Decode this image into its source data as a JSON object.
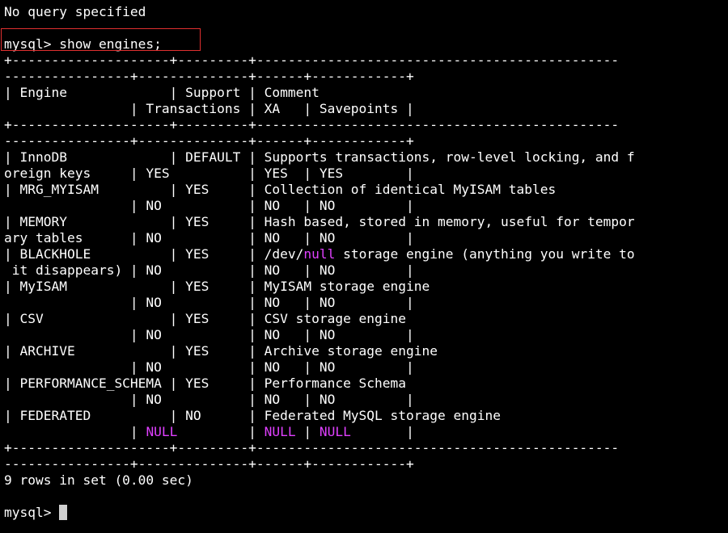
{
  "colors": {
    "background": "#000000",
    "text": "#ffffff",
    "null_highlight": "#e040ff",
    "annotation_box": "#e03030",
    "cursor": "#cfcfcf"
  },
  "lines": [
    [
      {
        "t": "No query specified"
      }
    ],
    [
      {
        "t": ""
      }
    ],
    [
      {
        "t": "mysql> show engines;"
      }
    ],
    [
      {
        "t": "+--------------------+---------+----------------------------------------------"
      }
    ],
    [
      {
        "t": "----------------+--------------+------+------------+"
      }
    ],
    [
      {
        "t": "| Engine             | Support | Comment"
      }
    ],
    [
      {
        "t": "                | Transactions | XA   | Savepoints |"
      }
    ],
    [
      {
        "t": "+--------------------+---------+----------------------------------------------"
      }
    ],
    [
      {
        "t": "----------------+--------------+------+------------+"
      }
    ],
    [
      {
        "t": "| InnoDB             | DEFAULT | Supports transactions, row-level locking, and f"
      }
    ],
    [
      {
        "t": "oreign keys     | YES          | YES  | YES        |"
      }
    ],
    [
      {
        "t": "| MRG_MYISAM         | YES     | Collection of identical MyISAM tables"
      }
    ],
    [
      {
        "t": "                | NO           | NO   | NO         |"
      }
    ],
    [
      {
        "t": "| MEMORY             | YES     | Hash based, stored in memory, useful for tempor"
      }
    ],
    [
      {
        "t": "ary tables      | NO           | NO   | NO         |"
      }
    ],
    [
      {
        "t": "| BLACKHOLE          | YES     | /dev/"
      },
      {
        "t": "null",
        "c": "magenta"
      },
      {
        "t": " storage engine (anything you write to"
      }
    ],
    [
      {
        "t": " it disappears) | NO           | NO   | NO         |"
      }
    ],
    [
      {
        "t": "| MyISAM             | YES     | MyISAM storage engine"
      }
    ],
    [
      {
        "t": "                | NO           | NO   | NO         |"
      }
    ],
    [
      {
        "t": "| CSV                | YES     | CSV storage engine"
      }
    ],
    [
      {
        "t": "                | NO           | NO   | NO         |"
      }
    ],
    [
      {
        "t": "| ARCHIVE            | YES     | Archive storage engine"
      }
    ],
    [
      {
        "t": "                | NO           | NO   | NO         |"
      }
    ],
    [
      {
        "t": "| PERFORMANCE_SCHEMA | YES     | Performance Schema"
      }
    ],
    [
      {
        "t": "                | NO           | NO   | NO         |"
      }
    ],
    [
      {
        "t": "| FEDERATED          | NO      | Federated MySQL storage engine"
      }
    ],
    [
      {
        "t": "                | "
      },
      {
        "t": "NULL",
        "c": "magenta"
      },
      {
        "t": "         | "
      },
      {
        "t": "NULL",
        "c": "magenta"
      },
      {
        "t": " | "
      },
      {
        "t": "NULL",
        "c": "magenta"
      },
      {
        "t": "       |"
      }
    ],
    [
      {
        "t": "+--------------------+---------+----------------------------------------------"
      }
    ],
    [
      {
        "t": "----------------+--------------+------+------------+"
      }
    ],
    [
      {
        "t": "9 rows in set (0.00 sec)"
      }
    ],
    [
      {
        "t": ""
      }
    ]
  ],
  "prompt": "mysql> "
}
